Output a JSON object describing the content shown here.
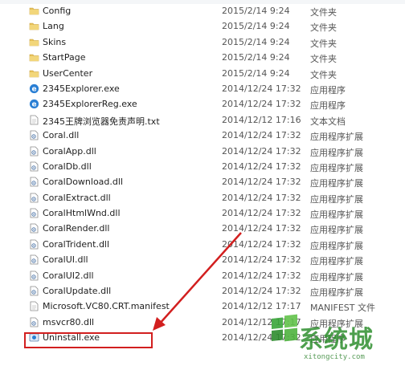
{
  "files": [
    {
      "name": "Config",
      "date": "2015/2/14 9:24",
      "type": "文件夹",
      "icon": "folder-icon"
    },
    {
      "name": "Lang",
      "date": "2015/2/14 9:24",
      "type": "文件夹",
      "icon": "folder-icon"
    },
    {
      "name": "Skins",
      "date": "2015/2/14 9:24",
      "type": "文件夹",
      "icon": "folder-icon"
    },
    {
      "name": "StartPage",
      "date": "2015/2/14 9:24",
      "type": "文件夹",
      "icon": "folder-icon"
    },
    {
      "name": "UserCenter",
      "date": "2015/2/14 9:24",
      "type": "文件夹",
      "icon": "folder-icon"
    },
    {
      "name": "2345Explorer.exe",
      "date": "2014/12/24 17:32",
      "type": "应用程序",
      "icon": "browser-exe-icon"
    },
    {
      "name": "2345ExplorerReg.exe",
      "date": "2014/12/24 17:32",
      "type": "应用程序",
      "icon": "browser-exe-icon"
    },
    {
      "name": "2345王牌浏览器免责声明.txt",
      "date": "2014/12/12 17:16",
      "type": "文本文档",
      "icon": "text-file-icon"
    },
    {
      "name": "Coral.dll",
      "date": "2014/12/24 17:32",
      "type": "应用程序扩展",
      "icon": "dll-icon"
    },
    {
      "name": "CoralApp.dll",
      "date": "2014/12/24 17:32",
      "type": "应用程序扩展",
      "icon": "dll-icon"
    },
    {
      "name": "CoralDb.dll",
      "date": "2014/12/24 17:32",
      "type": "应用程序扩展",
      "icon": "dll-icon"
    },
    {
      "name": "CoralDownload.dll",
      "date": "2014/12/24 17:32",
      "type": "应用程序扩展",
      "icon": "dll-icon"
    },
    {
      "name": "CoralExtract.dll",
      "date": "2014/12/24 17:32",
      "type": "应用程序扩展",
      "icon": "dll-icon"
    },
    {
      "name": "CoralHtmlWnd.dll",
      "date": "2014/12/24 17:32",
      "type": "应用程序扩展",
      "icon": "dll-icon"
    },
    {
      "name": "CoralRender.dll",
      "date": "2014/12/24 17:32",
      "type": "应用程序扩展",
      "icon": "dll-icon"
    },
    {
      "name": "CoralTrident.dll",
      "date": "2014/12/24 17:32",
      "type": "应用程序扩展",
      "icon": "dll-icon"
    },
    {
      "name": "CoralUI.dll",
      "date": "2014/12/24 17:32",
      "type": "应用程序扩展",
      "icon": "dll-icon"
    },
    {
      "name": "CoralUI2.dll",
      "date": "2014/12/24 17:32",
      "type": "应用程序扩展",
      "icon": "dll-icon"
    },
    {
      "name": "CoralUpdate.dll",
      "date": "2014/12/24 17:32",
      "type": "应用程序扩展",
      "icon": "dll-icon"
    },
    {
      "name": "Microsoft.VC80.CRT.manifest",
      "date": "2014/12/12 17:17",
      "type": "MANIFEST 文件",
      "icon": "manifest-file-icon"
    },
    {
      "name": "msvcr80.dll",
      "date": "2014/12/12 17:17",
      "type": "应用程序扩展",
      "icon": "dll-icon"
    },
    {
      "name": "Uninstall.exe",
      "date": "2014/12/24 17:32",
      "type": "应用程序",
      "icon": "uninstall-exe-icon"
    }
  ],
  "annotation": {
    "highlighted_file": "Uninstall.exe",
    "color": "#d21f1f"
  },
  "watermark": {
    "text": "系统城",
    "sub": "xitongcity.com",
    "icon": "windows-logo-icon"
  },
  "colors": {
    "folder": "#e8c25a",
    "browser": "#2a7fd4",
    "text": "#1e1e1e"
  }
}
